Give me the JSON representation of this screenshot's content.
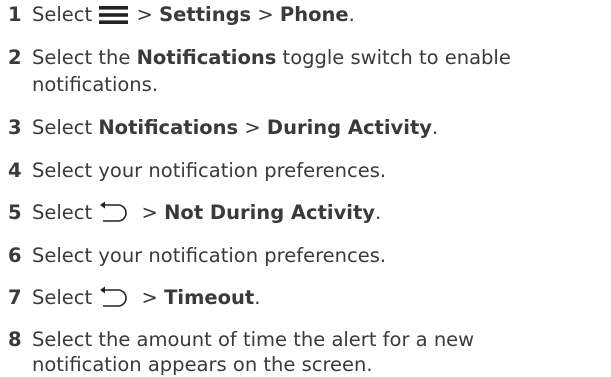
{
  "steps": [
    {
      "num": "1",
      "text1": "Select ",
      "icon": "hamburger-menu-icon",
      "sep1": " > ",
      "b1": "Settings",
      "sep2": " > ",
      "b2": "Phone",
      "end": "."
    },
    {
      "num": "2",
      "text1": "Select the ",
      "b1": "Notifications",
      "text2": " toggle switch to enable",
      "line2": "notifications."
    },
    {
      "num": "3",
      "text1": "Select ",
      "b1": "Notifications",
      "sep1": " > ",
      "b2": "During Activity",
      "end": "."
    },
    {
      "num": "4",
      "text1": "Select your notification preferences."
    },
    {
      "num": "5",
      "text1": "Select ",
      "icon": "back-arrow-icon",
      "sep1": " > ",
      "b1": "Not During Activity",
      "end": "."
    },
    {
      "num": "6",
      "text1": "Select your notification preferences."
    },
    {
      "num": "7",
      "text1": "Select ",
      "icon": "back-arrow-icon",
      "sep1": " > ",
      "b1": "Timeout",
      "end": "."
    },
    {
      "num": "8",
      "text1": "Select the amount of time the alert for a new",
      "line2": "notification appears on the screen."
    }
  ]
}
